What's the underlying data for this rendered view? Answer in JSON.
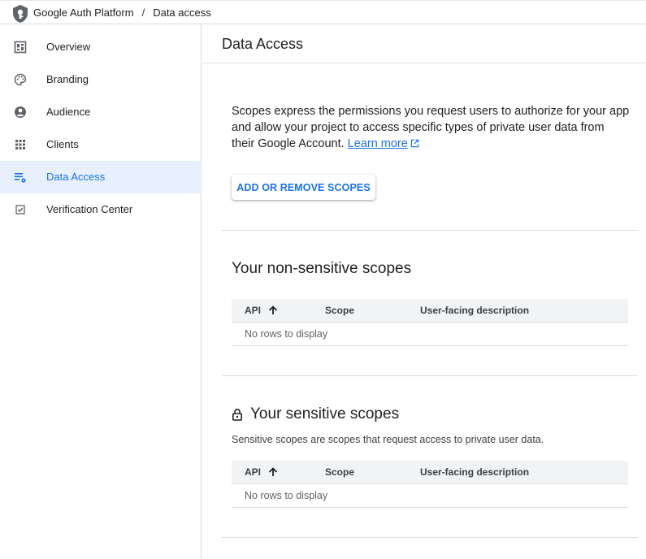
{
  "header": {
    "app_name": "Google Auth Platform",
    "separator": "/",
    "current_page": "Data access"
  },
  "sidebar": {
    "items": [
      {
        "label": "Overview",
        "icon": "dashboard-icon"
      },
      {
        "label": "Branding",
        "icon": "palette-icon"
      },
      {
        "label": "Audience",
        "icon": "account-circle-icon"
      },
      {
        "label": "Clients",
        "icon": "grid-icon"
      },
      {
        "label": "Data Access",
        "icon": "data-access-icon",
        "active": true
      },
      {
        "label": "Verification Center",
        "icon": "checkbox-icon"
      }
    ]
  },
  "main": {
    "title": "Data Access",
    "intro_text": "Scopes express the permissions you request users to authorize for your app and allow your project to access specific types of private user data from their Google Account. ",
    "learn_more": "Learn more",
    "add_scopes_button": "ADD OR REMOVE SCOPES",
    "non_sensitive": {
      "title": "Your non-sensitive scopes",
      "columns": [
        "API",
        "Scope",
        "User-facing description"
      ],
      "empty_text": "No rows to display"
    },
    "sensitive": {
      "title": "Your sensitive scopes",
      "description": "Sensitive scopes are scopes that request access to private user data.",
      "columns": [
        "API",
        "Scope",
        "User-facing description"
      ],
      "empty_text": "No rows to display"
    }
  },
  "colors": {
    "accent": "#1a73e8",
    "active_bg": "#e8f0fe",
    "divider": "#dadce0",
    "table_header_bg": "#f1f3f4"
  }
}
